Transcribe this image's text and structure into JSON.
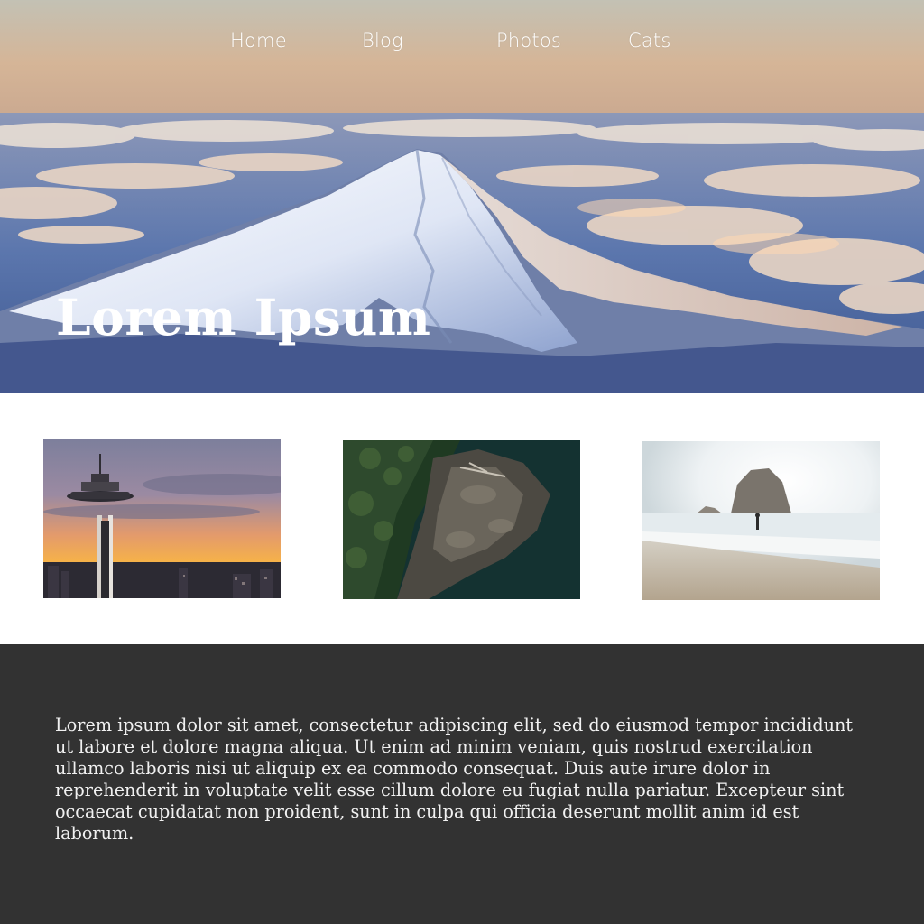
{
  "nav": {
    "items": [
      {
        "label": "Home"
      },
      {
        "label": "Blog"
      },
      {
        "label": "Photos"
      },
      {
        "label": "Cats"
      }
    ]
  },
  "hero": {
    "title": "Lorem Ipsum",
    "image": "snow-capped-mountain-above-clouds"
  },
  "gallery": {
    "images": [
      {
        "subject": "space-needle-at-sunset"
      },
      {
        "subject": "aerial-rocky-forest-coastline"
      },
      {
        "subject": "person-walking-on-beach-with-sea-stack"
      }
    ]
  },
  "footer": {
    "text": "Lorem ipsum dolor sit amet, consectetur adipiscing elit, sed do eiusmod tempor incididunt ut labore et dolore magna aliqua. Ut enim ad minim veniam, quis nostrud exercitation ullamco laboris nisi ut aliquip ex ea commodo consequat. Duis aute irure dolor in reprehenderit in voluptate velit esse cillum dolore eu fugiat nulla pariatur. Excepteur sint occaecat cupidatat non proident, sunt in culpa qui officia deserunt mollit anim id est laborum."
  },
  "colors": {
    "footer_background": "#323232",
    "footer_text": "#f1f1f1",
    "hero_text": "#ffffff",
    "page_background": "#ffffff"
  }
}
